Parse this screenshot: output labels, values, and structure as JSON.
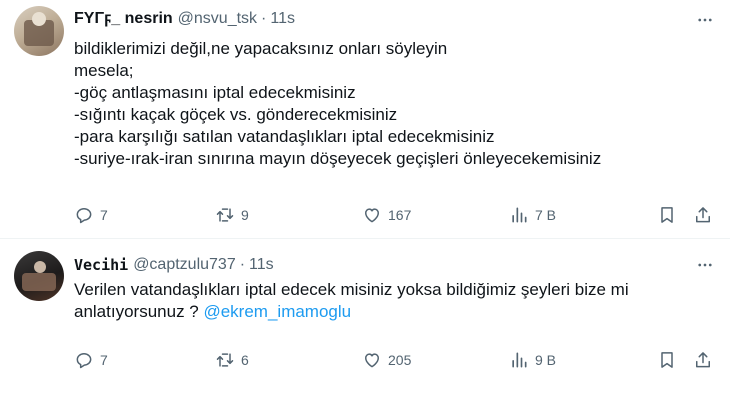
{
  "tweets": [
    {
      "display_name": "FYΓϝ_ nesrin",
      "handle": "@nsvu_tsk",
      "separator": "·",
      "time": "11s",
      "lines": [
        "bildiklerimizi değil,ne yapacaksınız onları söyleyin",
        "mesela;",
        "-göç antlaşmasını iptal edecekmisiniz",
        "-sığıntı kaçak göçek vs. gönderecekmisiniz",
        "-para karşılığı satılan vatandaşlıkları iptal edecekmisiniz",
        "-suriye-ırak-iran sınırına mayın döşeyecek geçişleri önleyecekemisiniz"
      ],
      "replies": "7",
      "retweets": "9",
      "likes": "167",
      "views": "7 B"
    },
    {
      "display_name": "Vecihi",
      "handle": "@captzulu737",
      "separator": "·",
      "time": "11s",
      "lines": [
        "Verilen vatandaşlıkları iptal edecek misiniz yoksa bildiğimiz şeyleri bize mi"
      ],
      "line2_text": "anlatıyorsunuz ? ",
      "mention": "@ekrem_imamoglu",
      "replies": "7",
      "retweets": "6",
      "likes": "205",
      "views": "9 B"
    }
  ],
  "colors": {
    "text": "#0f1419",
    "secondary": "#536471",
    "link": "#1d9bf0",
    "divider": "#eff3f4",
    "background": "#ffffff"
  },
  "icons": [
    "more-icon",
    "reply-icon",
    "retweet-icon",
    "like-icon",
    "views-icon",
    "bookmark-icon",
    "share-icon"
  ]
}
